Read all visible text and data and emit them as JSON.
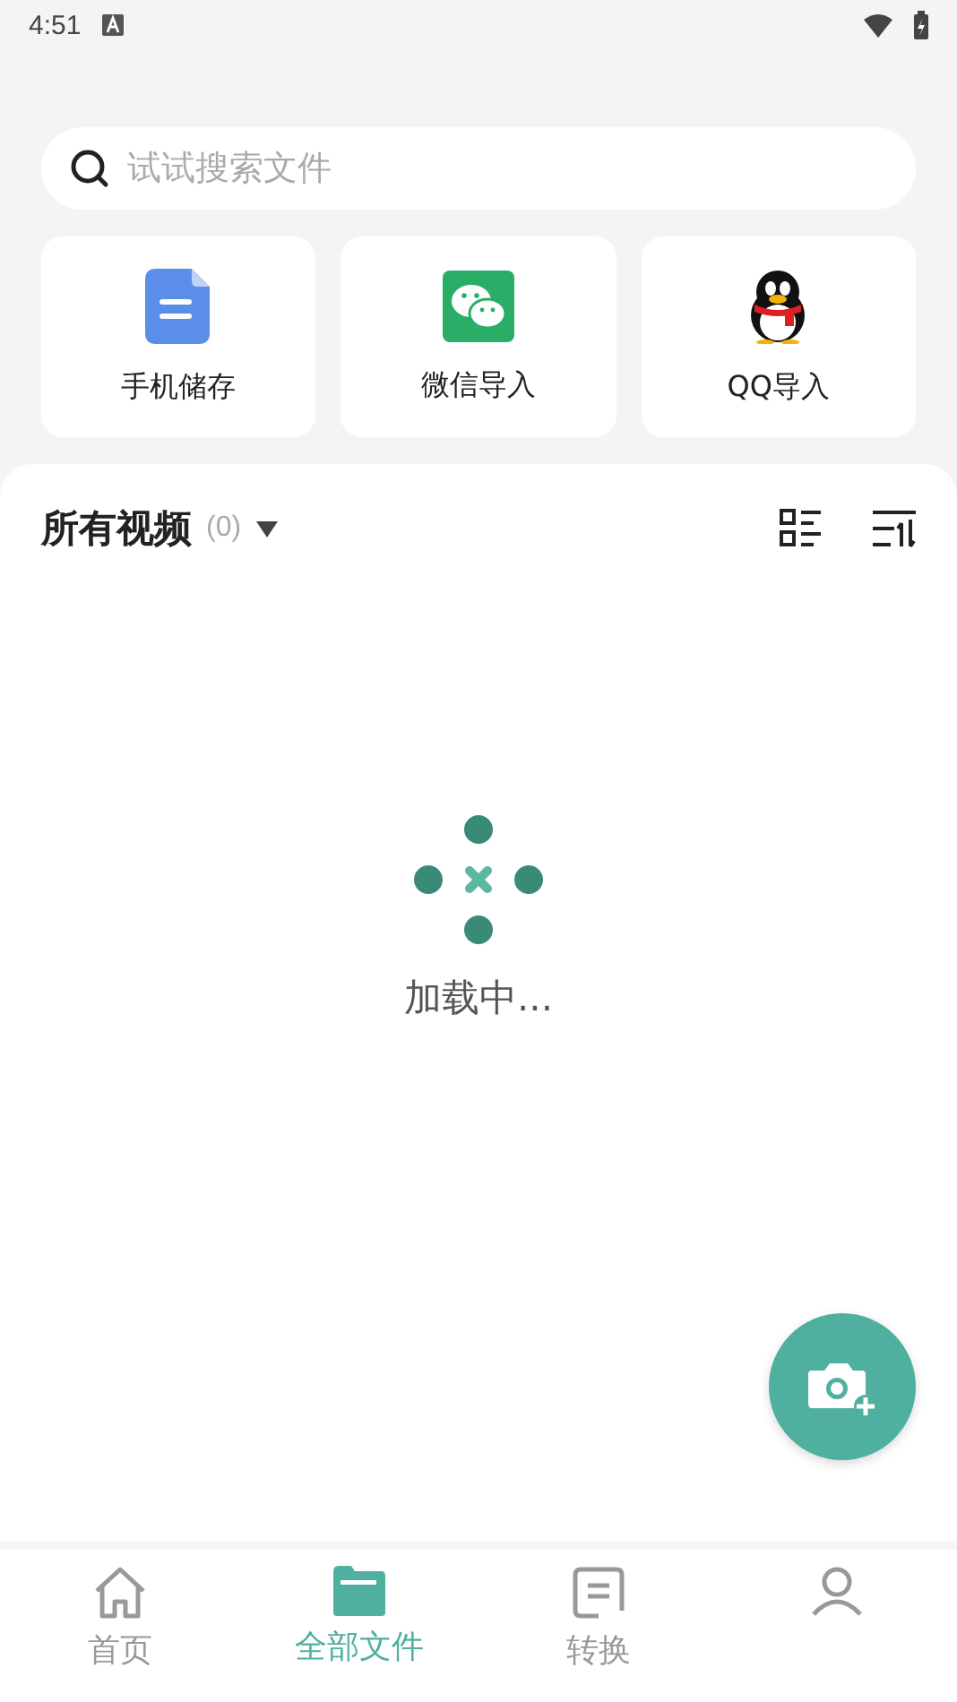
{
  "status_bar": {
    "time": "4:51"
  },
  "search": {
    "placeholder": "试试搜索文件"
  },
  "sources": [
    {
      "kind": "doc",
      "label": "手机储存"
    },
    {
      "kind": "wechat",
      "label": "微信导入"
    },
    {
      "kind": "qq",
      "label": "QQ导入"
    }
  ],
  "section": {
    "title": "所有视频",
    "count": "(0)"
  },
  "loading": {
    "text": "加载中..."
  },
  "tabs": [
    {
      "kind": "home",
      "label": "首页",
      "selected": false
    },
    {
      "kind": "files",
      "label": "全部文件",
      "selected": true
    },
    {
      "kind": "convert",
      "label": "转换",
      "selected": false
    },
    {
      "kind": "profile",
      "selected": false
    }
  ]
}
